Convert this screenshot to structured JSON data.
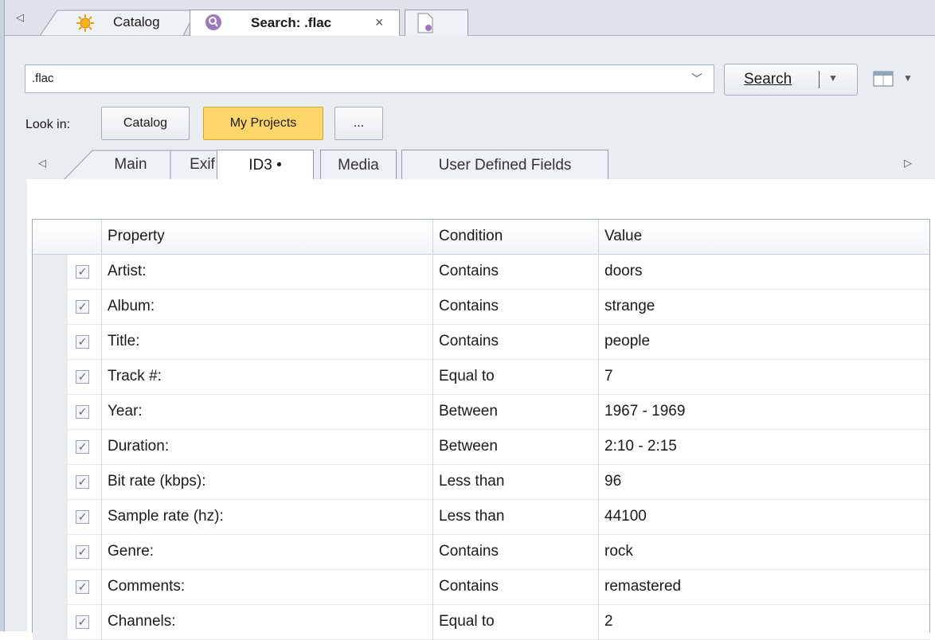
{
  "doc_tabs": {
    "catalog_label": "Catalog",
    "search_label": "Search: .flac",
    "close_glyph": "×",
    "icons": [
      "sun-icon",
      "search-magnifier-icon",
      "document-icon"
    ]
  },
  "search": {
    "query": ".flac",
    "button_label": "Search"
  },
  "look_in": {
    "label": "Look in:",
    "options": [
      "Catalog",
      "My Projects",
      "..."
    ],
    "active": "My Projects"
  },
  "sub_tabs": {
    "items": [
      "Main",
      "Exif",
      "ID3 •",
      "Media",
      "User Defined Fields"
    ],
    "active": "ID3 •"
  },
  "grid": {
    "columns": [
      "Property",
      "Condition",
      "Value"
    ],
    "rows": [
      {
        "checked": true,
        "property": "Artist:",
        "condition": "Contains",
        "value": "doors"
      },
      {
        "checked": true,
        "property": "Album:",
        "condition": "Contains",
        "value": "strange"
      },
      {
        "checked": true,
        "property": "Title:",
        "condition": "Contains",
        "value": "people"
      },
      {
        "checked": true,
        "property": "Track #:",
        "condition": "Equal to",
        "value": "7"
      },
      {
        "checked": true,
        "property": "Year:",
        "condition": "Between",
        "value": "1967 - 1969"
      },
      {
        "checked": true,
        "property": "Duration:",
        "condition": "Between",
        "value": "2:10 - 2:15"
      },
      {
        "checked": true,
        "property": "Bit rate (kbps):",
        "condition": "Less than",
        "value": "96"
      },
      {
        "checked": true,
        "property": "Sample rate (hz):",
        "condition": "Less than",
        "value": "44100"
      },
      {
        "checked": true,
        "property": "Genre:",
        "condition": "Contains",
        "value": "rock"
      },
      {
        "checked": true,
        "property": "Comments:",
        "condition": "Contains",
        "value": "remastered"
      },
      {
        "checked": true,
        "property": "Channels:",
        "condition": "Equal to",
        "value": "2"
      }
    ]
  },
  "colors": {
    "active_chip": "#ffd66a",
    "panel_bg": "#e9ecf1",
    "border": "#8f9cad"
  }
}
